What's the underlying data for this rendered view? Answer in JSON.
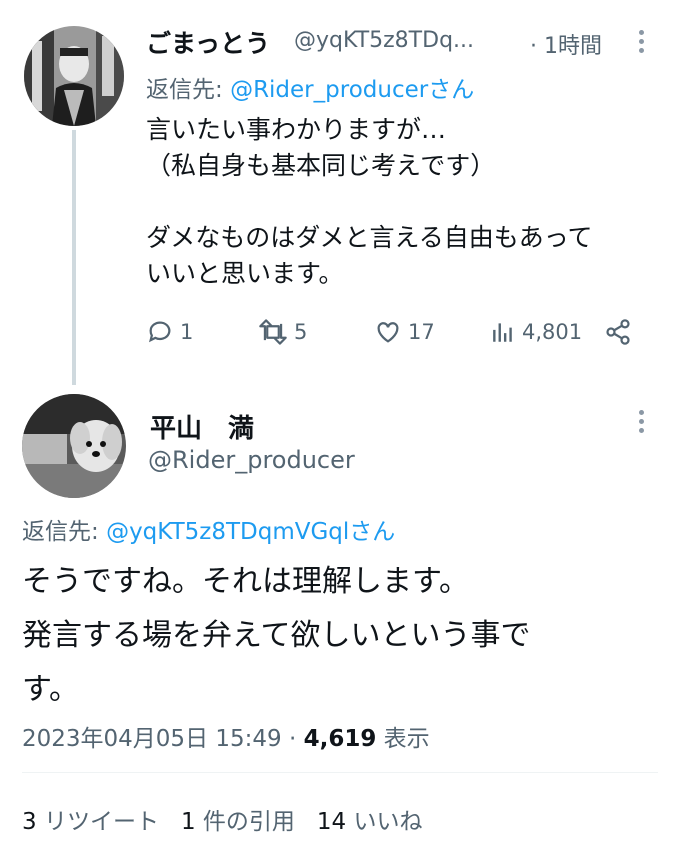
{
  "reply_tweet": {
    "display_name": "ごまっとう",
    "handle": "@yqKT5z8TDq...",
    "time": "· 1時間",
    "reply_prefix": "返信先: ",
    "reply_to": "@Rider_producer",
    "reply_suffix": "さん",
    "text": "言いたい事わかりますが…\n（私自身も基本同じ考えです）\n\nダメなものはダメと言える自由もあって\nいいと思います。",
    "replies": "1",
    "retweets": "5",
    "likes": "17",
    "views": "4,801"
  },
  "main_tweet": {
    "display_name": "平山　満",
    "handle": "@Rider_producer",
    "reply_prefix": "返信先: ",
    "reply_to": "@yqKT5z8TDqmVGql",
    "reply_suffix": "さん",
    "text": "そうですね。それは理解します。\n発言する場を弁えて欲しいという事で\nす。",
    "timestamp": "2023年04月05日 15:49 · ",
    "view_count": "4,619",
    "view_label": " 表示",
    "retweet_count": "3",
    "retweet_label": " リツイート",
    "quote_count": "1",
    "quote_label": " 件の引用",
    "like_count": "14",
    "like_label": " いいね"
  },
  "colors": {
    "link": "#1d9bf0",
    "secondary": "#536471",
    "text": "#0f1419"
  },
  "icons": [
    "reply-icon",
    "retweet-icon",
    "like-icon",
    "views-icon",
    "share-icon",
    "more-icon"
  ]
}
